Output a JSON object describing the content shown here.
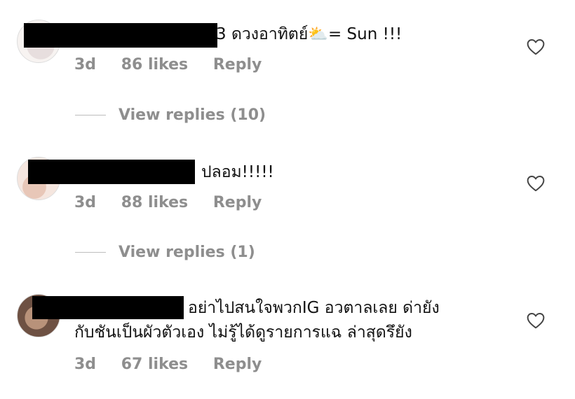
{
  "comments": [
    {
      "text": "3 ดวงอาทิตย์⛅= Sun !!!",
      "time": "3d",
      "likes": "86 likes",
      "reply": "Reply",
      "view_replies": "View replies (10)"
    },
    {
      "text": "ปลอม!!!!!",
      "time": "3d",
      "likes": "88 likes",
      "reply": "Reply",
      "view_replies": "View replies (1)"
    },
    {
      "text_line1": "อย่าไปสนใจพวกIG อวตาลเลย ด่ายัง",
      "text_line2": "กับชันเป็นผัวตัวเอง ไม่รู้ได้ดูรายการแฉ ล่าสุดรึยัง",
      "time": "3d",
      "likes": "67 likes",
      "reply": "Reply"
    }
  ],
  "icons": {
    "like": "heart-outline-icon"
  },
  "colors": {
    "meta": "#8e8e8e",
    "text": "#111111",
    "redaction": "#000000"
  }
}
